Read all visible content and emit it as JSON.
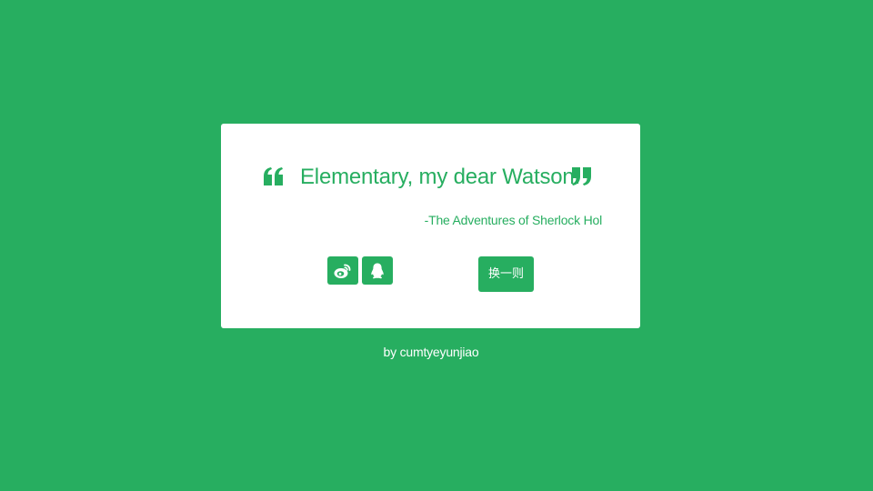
{
  "theme": {
    "background": "#27ae60",
    "card": "#ffffff",
    "accent": "#27ae60"
  },
  "quote": {
    "open_icon": "quote-left-icon",
    "text": "Elementary, my dear Watson.",
    "close_icon": "quote-right-icon",
    "author": "-The Adventures of Sherlock Hol"
  },
  "share": {
    "weibo_icon": "weibo-icon",
    "qq_icon": "qq-penguin-icon"
  },
  "actions": {
    "new_quote_label": "换一则"
  },
  "footer": {
    "text": "by cumtyeyunjiao"
  }
}
